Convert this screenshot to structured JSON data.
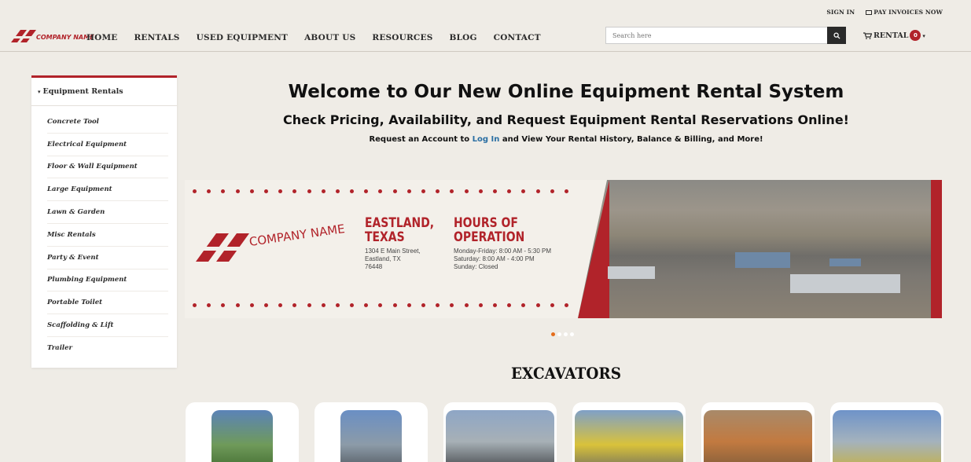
{
  "utility": {
    "sign_in": "SIGN IN",
    "pay_invoices": "PAY INVOICES NOW"
  },
  "brand": {
    "name": "COMPANY NAME",
    "accent": "#b1232a"
  },
  "nav": [
    "HOME",
    "RENTALS",
    "USED EQUIPMENT",
    "ABOUT US",
    "RESOURCES",
    "BLOG",
    "CONTACT"
  ],
  "search": {
    "placeholder": "Search here",
    "icon": "search-icon"
  },
  "cart": {
    "label": "RENTAL",
    "count": "0",
    "icon": "cart-icon"
  },
  "sidebar": {
    "title": "Equipment Rentals",
    "items": [
      "Concrete Tool",
      "Electrical Equipment",
      "Floor & Wall Equipment",
      "Large Equipment",
      "Lawn & Garden",
      "Misc Rentals",
      "Party & Event",
      "Plumbing Equipment",
      "Portable Toilet",
      "Scaffolding & Lift",
      "Trailer"
    ]
  },
  "welcome": {
    "title": "Welcome to Our New Online Equipment Rental System",
    "subtitle": "Check Pricing, Availability, and Request Equipment Rental Reservations Online!",
    "line_pre": "Request an Account to ",
    "login_link": "Log In",
    "line_post": " and View Your Rental History, Balance & Billing, and More!"
  },
  "banner": {
    "company": "COMPANY NAME",
    "location_title_1": "EASTLAND,",
    "location_title_2": "TEXAS",
    "address_1": "1304 E Main Street,",
    "address_2": "Eastland, TX",
    "address_3": "76448",
    "hours_title_1": "HOURS OF",
    "hours_title_2": "OPERATION",
    "hours_1": "Monday-Friday: 8:00 AM - 5:30 PM",
    "hours_2": "Saturday: 8:00 AM - 4:00 PM",
    "hours_3": "Sunday: Closed"
  },
  "carousel": {
    "slides": 4,
    "active": 1
  },
  "section": {
    "title": "EXCAVATORS"
  }
}
